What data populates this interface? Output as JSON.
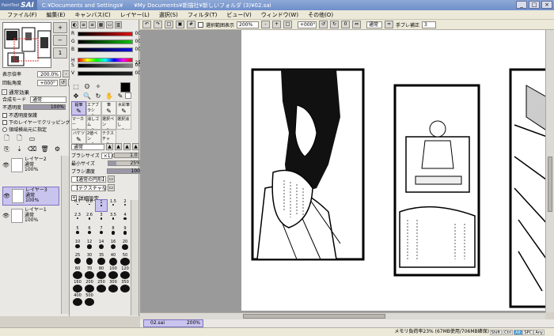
{
  "titlebar": {
    "logo_small": "PaintTool",
    "logo_text": "SAI",
    "title": "C:¥Documents and Settings¥　　¥My Documents¥新描社¥新しいフォルダ (3)¥02.sai",
    "buttons": [
      "_",
      "□",
      "×"
    ]
  },
  "menu": [
    "ファイル(F)",
    "編集(E)",
    "キャンバス(C)",
    "レイヤー(L)",
    "選択(S)",
    "フィルタ(T)",
    "ビュー(V)",
    "ウィンドウ(W)",
    "その他(O)"
  ],
  "navigator": {
    "zoom_label": "表示倍率",
    "zoom_value": "200.0%",
    "rotate_label": "回転角度",
    "rotate_value": "+000°"
  },
  "layer_props": {
    "header": "通常効果",
    "blend_label": "合成モード",
    "blend_value": "通常",
    "opacity_label": "不透明度",
    "opacity_value": "100%",
    "opacity": 1.0,
    "checks": [
      "不透明度保護",
      "下のレイヤーでクリッピング",
      "領域検出元に指定"
    ]
  },
  "layers": [
    {
      "name": "レイヤー2",
      "mode": "通常",
      "opacity": "100%",
      "selected": false
    },
    {
      "name": "レイヤー3",
      "mode": "通常",
      "opacity": "100%",
      "selected": true
    },
    {
      "name": "レイヤー1",
      "mode": "通常",
      "opacity": "100%",
      "selected": false
    }
  ],
  "color": {
    "channels": [
      {
        "label": "R",
        "value": "000",
        "color": "#e01010"
      },
      {
        "label": "G",
        "value": "000",
        "color": "#10c010"
      },
      {
        "label": "B",
        "value": "000",
        "color": "#1010e0"
      },
      {
        "label": "H",
        "value": "S 255",
        "color": "hue"
      },
      {
        "label": "S",
        "value": "000",
        "color": "#888888"
      },
      {
        "label": "V",
        "value": "000",
        "color": "#222222"
      }
    ],
    "primary": "#000000",
    "secondary": "#ffffff"
  },
  "tools": {
    "grid_tools": [
      {
        "label": "鉛筆",
        "selected": true
      },
      {
        "label": "エアブラシ",
        "selected": false
      },
      {
        "label": "筆",
        "selected": false
      },
      {
        "label": "水彩筆",
        "selected": false
      },
      {
        "label": "マーカー",
        "selected": false
      },
      {
        "label": "消しゴム",
        "selected": false
      },
      {
        "label": "選択ペン",
        "selected": false
      },
      {
        "label": "選択消し",
        "selected": false
      },
      {
        "label": "バケツ",
        "selected": false
      },
      {
        "label": "2値ペン",
        "selected": false
      },
      {
        "label": "テクスチャ",
        "selected": false
      }
    ],
    "mode_value": "通常",
    "size_label": "ブラシサイズ",
    "size_mult": "×1.0",
    "size_value": "1.0",
    "min_label": "最小サイズ",
    "min_value": "25%",
    "density_label": "ブラシ濃度",
    "density_value": "100",
    "edge_value": "【通常の円形】",
    "texture_value": "【テクスチャなし】",
    "detail_label": "詳細設定"
  },
  "brush_sizes": [
    "0.7",
    "0.8",
    "1",
    "1.5",
    "2",
    "2.3",
    "2.6",
    "3",
    "3.5",
    "4",
    "5",
    "6",
    "7",
    "8",
    "9",
    "10",
    "12",
    "14",
    "16",
    "20",
    "25",
    "30",
    "35",
    "40",
    "50",
    "60",
    "70",
    "80",
    "100",
    "120",
    "160",
    "200",
    "250",
    "300",
    "350",
    "400",
    "500"
  ],
  "canvas_toolbar": {
    "show_selection": "選択範囲表示",
    "zoom": "200%",
    "angle": "+000°",
    "mode": "通常",
    "stabilizer_label": "手ブレ補正",
    "stabilizer_value": "3"
  },
  "document_tab": {
    "name": "02.sai",
    "zoom": "200%"
  },
  "status": {
    "memory": "メモリ負荷率23% (67MB使用/706MB確保)",
    "indicators": [
      "Shift",
      "Ctrl",
      "Alt",
      "SPC",
      "Any"
    ]
  }
}
